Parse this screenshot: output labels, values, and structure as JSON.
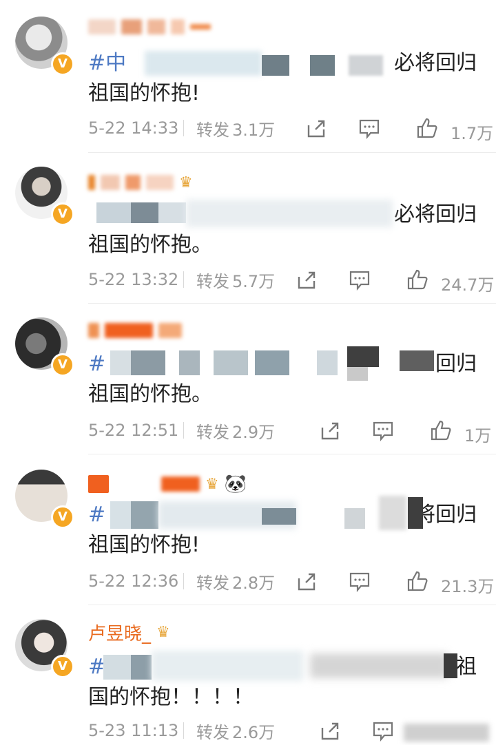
{
  "posts": [
    {
      "name_visible": "",
      "content_prefix": "#中",
      "content_tail": "必将回归",
      "content_line2": "祖国的怀抱!",
      "time": "5-22 14:33",
      "repost_label": "转发",
      "repost_count": "3.1万",
      "like_count": "1.7万",
      "avatar_colors": [
        "#c9c9c9",
        "#6f6f6f"
      ]
    },
    {
      "name_visible": "",
      "content_prefix": "",
      "content_tail": "必将回归",
      "content_line2": "祖国的怀抱。",
      "time": "5-22 13:32",
      "repost_label": "转发",
      "repost_count": "5.7万",
      "like_count": "24.7万",
      "avatar_colors": [
        "#b9b9b9",
        "#3c3c3c"
      ]
    },
    {
      "name_visible": "",
      "content_prefix": "#",
      "content_tail": "回归",
      "content_line2": "祖国的怀抱。",
      "time": "5-22 12:51",
      "repost_label": "转发",
      "repost_count": "2.9万",
      "like_count": "1万",
      "avatar_colors": [
        "#5a5a5a",
        "#2a2a2a"
      ]
    },
    {
      "name_visible": "",
      "content_prefix": "#",
      "content_tail": "将回归",
      "content_line2": "祖国的怀抱!",
      "time": "5-22 12:36",
      "repost_label": "转发",
      "repost_count": "2.8万",
      "like_count": "21.3万",
      "avatar_colors": [
        "#d4cfc8",
        "#7a6c5e"
      ]
    },
    {
      "name_visible": "卢昱晓_",
      "content_prefix": "#",
      "content_tail": "祖",
      "content_line2": "国的怀抱！！！！",
      "time": "5-23 11:13",
      "repost_label": "转发",
      "repost_count": "2.6万",
      "like_count": "",
      "avatar_colors": [
        "#d8d8d8",
        "#4b4b4b"
      ]
    }
  ],
  "colors": {
    "name": "#e96a1e",
    "topic": "#4d79c3",
    "vbadge": "#f5a623",
    "meta": "#9a9a9a"
  },
  "icons": {
    "verified": "v-badge-icon",
    "share": "share-icon",
    "comment": "comment-icon",
    "like": "thumbs-up-icon",
    "crown": "crown-icon",
    "panda": "panda-icon"
  }
}
